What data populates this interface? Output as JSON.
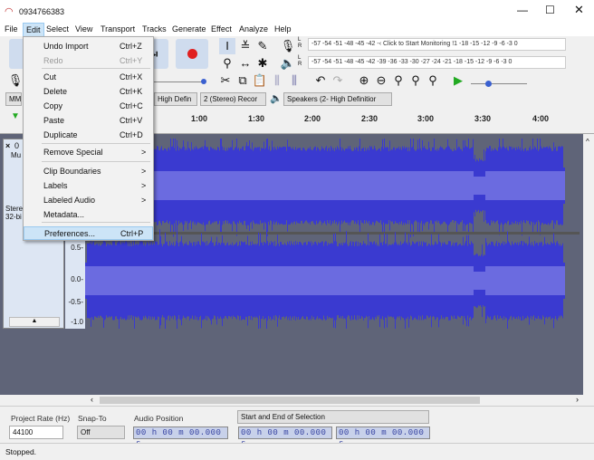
{
  "window": {
    "title": "0934766383",
    "icon": "headphones-icon",
    "controls": [
      "minimize-icon",
      "maximize-icon",
      "close-icon"
    ]
  },
  "menubar": [
    "File",
    "Edit",
    "Select",
    "View",
    "Transport",
    "Tracks",
    "Generate",
    "Effect",
    "Analyze",
    "Help"
  ],
  "edit_menu": [
    {
      "label": "Undo Import",
      "shortcut": "Ctrl+Z"
    },
    {
      "label": "Redo",
      "shortcut": "Ctrl+Y",
      "disabled": true
    },
    {
      "label": "Cut",
      "shortcut": "Ctrl+X"
    },
    {
      "label": "Delete",
      "shortcut": "Ctrl+K"
    },
    {
      "label": "Copy",
      "shortcut": "Ctrl+C"
    },
    {
      "label": "Paste",
      "shortcut": "Ctrl+V"
    },
    {
      "label": "Duplicate",
      "shortcut": "Ctrl+D"
    },
    {
      "label": "Remove Special",
      "shortcut": ">"
    },
    {
      "label": "Clip Boundaries",
      "shortcut": ">"
    },
    {
      "label": "Labels",
      "shortcut": ">"
    },
    {
      "label": "Labeled Audio",
      "shortcut": ">"
    },
    {
      "label": "Metadata..."
    },
    {
      "label": "Preferences...",
      "shortcut": "Ctrl+P",
      "highlighted": true
    }
  ],
  "meters": {
    "record": "-57 -54 -51 -48 -45 -42 -‹ Click to Start Monitoring !1 -18 -15 -12  -9  -6  -3  0",
    "playback": "-57 -54 -51 -48 -45 -42 -39 -36 -33 -30 -27 -24 -21 -18 -15 -12  -9  -6  -3  0",
    "lr": [
      "L",
      "R"
    ]
  },
  "devices": {
    "host": "MME",
    "recording_device": "High Defin",
    "channels": "2 (Stereo) Recor",
    "playback_device": "Speakers (2- High Definitior"
  },
  "timeline": [
    "1:00",
    "1:30",
    "2:00",
    "2:30",
    "3:00",
    "3:30",
    "4:00"
  ],
  "track": {
    "name": "0",
    "mute": "Mu",
    "info": [
      "Stere",
      "32-bi"
    ],
    "scale": [
      "1.0",
      "0.5-",
      "0.0-",
      "-0.5-",
      "-1.0"
    ]
  },
  "colors": {
    "wave": "#3a3ad0",
    "rms": "#6b6be0",
    "highlight": "#cce4f7"
  },
  "selection_toolbar": {
    "project_rate_label": "Project Rate (Hz)",
    "project_rate": "44100",
    "snap_to_label": "Snap-To",
    "snap_to": "Off",
    "audio_position_label": "Audio Position",
    "audio_position": "00 h 00 m 00.000 s",
    "selection_label": "Start and End of Selection",
    "sel_start": "00 h 00 m 00.000 s",
    "sel_end": "00 h 00 m 00.000 s"
  },
  "status": "Stopped."
}
